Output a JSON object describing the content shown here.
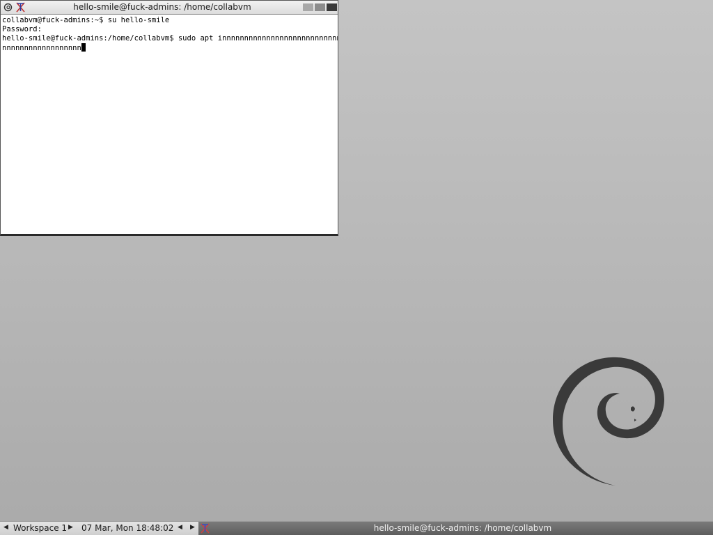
{
  "window": {
    "title": "hello-smile@fuck-admins: /home/collabvm",
    "icons": [
      "debian-swirl-icon",
      "xterm-icon"
    ],
    "buttons": [
      "minimize",
      "maximize",
      "close"
    ]
  },
  "terminal": {
    "lines": [
      "collabvm@fuck-admins:~$ su hello-smile",
      "Password:",
      "hello-smile@fuck-admins:/home/collabvm$ sudo apt innnnnnnnnnnnnnnnnnnnnnnnnnnnnn",
      "nnnnnnnnnnnnnnnnnn"
    ]
  },
  "taskbar": {
    "workspace": "Workspace 1",
    "clock": "07 Mar, Mon 18:48:02",
    "task_label": "hello-smile@fuck-admins: /home/collabvm"
  },
  "colors": {
    "desktop": "#b8b8b8",
    "swirl": "#3a3a3a",
    "task_active": "#6a6a6a"
  }
}
